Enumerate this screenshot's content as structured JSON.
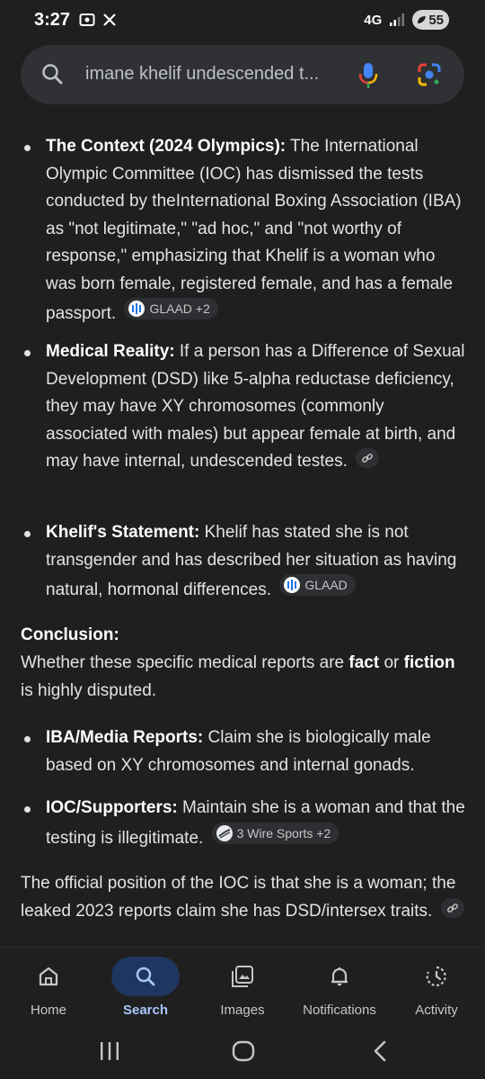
{
  "status_bar": {
    "time": "3:27",
    "network": "4G",
    "battery": "55"
  },
  "search": {
    "query": "imane khelif undescended t..."
  },
  "bullets_1": [
    {
      "title": "The Context (2024 Olympics):",
      "text": " The International Olympic Committee (IOC) has dismissed the tests conducted by theInternational Boxing Association (IBA) as \"not legitimate,\" \"ad hoc,\" and \"not worthy of response,\" emphasizing that Khelif is a woman who was born female, registered female, and has a female passport.",
      "source": "GLAAD +2"
    },
    {
      "title": "Medical Reality:",
      "text": " If a person has a Difference of Sexual Development (DSD) like 5-alpha reductase deficiency, they may have XY chromosomes (commonly associated with males) but appear female at birth, and may have internal, undescended testes.",
      "source": ""
    },
    {
      "title": "Khelif's Statement:",
      "text": " Khelif has stated she is not transgender and has described her situation as having natural, hormonal differences.",
      "source": "GLAAD"
    }
  ],
  "conclusion": {
    "heading": "Conclusion:",
    "text_a": "Whether these specific medical reports are ",
    "fact": "fact",
    "text_b": " or ",
    "fiction": "fiction",
    "text_c": " is highly disputed."
  },
  "bullets_2": [
    {
      "title": "IBA/Media Reports:",
      "text": " Claim she is biologically male based on XY chromosomes and internal gonads.",
      "source": ""
    },
    {
      "title": "IOC/Supporters:",
      "text": " Maintain she is a woman and that the testing is illegitimate.",
      "source": "3 Wire Sports +2"
    }
  ],
  "final_paragraph": "The official position of the IOC is that she is a woman; the leaked 2023 reports claim she has DSD/intersex traits.",
  "bottom_nav": [
    {
      "label": "Home",
      "icon": "home-icon",
      "active": false
    },
    {
      "label": "Search",
      "icon": "search-icon",
      "active": true
    },
    {
      "label": "Images",
      "icon": "images-icon",
      "active": false
    },
    {
      "label": "Notifications",
      "icon": "bell-icon",
      "active": false
    },
    {
      "label": "Activity",
      "icon": "activity-icon",
      "active": false
    }
  ],
  "colors": {
    "background": "#1f1f1f",
    "text": "#e3e3e3",
    "accent": "#a8c7fa",
    "active_pill": "#1f3760"
  }
}
